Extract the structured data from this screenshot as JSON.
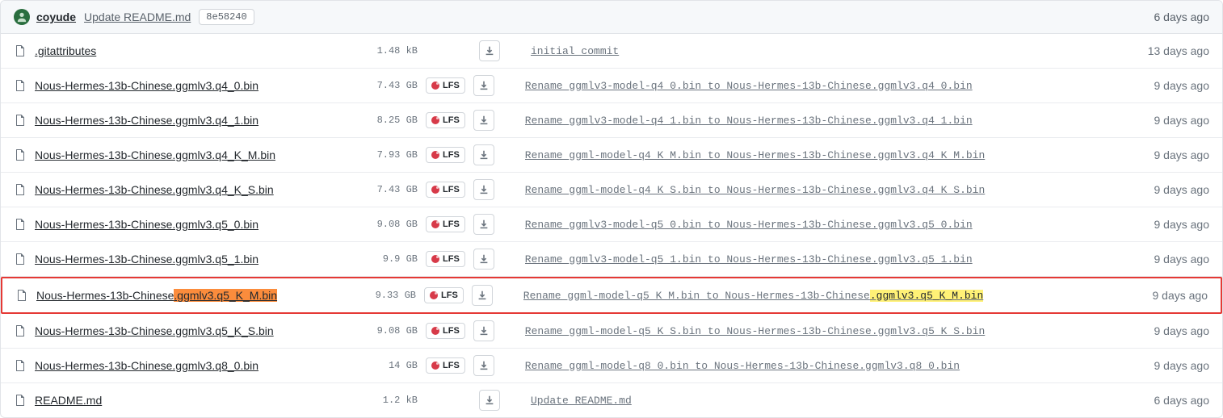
{
  "header": {
    "author": "coyude",
    "commit_title": "Update README.md",
    "commit_hash": "8e58240",
    "time": "6 days ago"
  },
  "lfs_label": "LFS",
  "rows": [
    {
      "name": ".gitattributes",
      "size": "1.48 kB",
      "lfs": false,
      "msg": "initial commit",
      "time": "13 days ago"
    },
    {
      "name": "Nous-Hermes-13b-Chinese.ggmlv3.q4_0.bin",
      "size": "7.43 GB",
      "lfs": true,
      "msg": "Rename ggmlv3-model-q4_0.bin to Nous-Hermes-13b-Chinese.ggmlv3.q4_0.bin",
      "time": "9 days ago"
    },
    {
      "name": "Nous-Hermes-13b-Chinese.ggmlv3.q4_1.bin",
      "size": "8.25 GB",
      "lfs": true,
      "underline": true,
      "msg": "Rename ggmlv3-model-q4_1.bin to Nous-Hermes-13b-Chinese.ggmlv3.q4_1.bin",
      "time": "9 days ago"
    },
    {
      "name": "Nous-Hermes-13b-Chinese.ggmlv3.q4_K_M.bin",
      "size": "7.93 GB",
      "lfs": true,
      "msg": "Rename ggml-model-q4_K_M.bin to Nous-Hermes-13b-Chinese.ggmlv3.q4_K_M.bin",
      "time": "9 days ago"
    },
    {
      "name": "Nous-Hermes-13b-Chinese.ggmlv3.q4_K_S.bin",
      "size": "7.43 GB",
      "lfs": true,
      "msg": "Rename ggml-model-q4_K_S.bin to Nous-Hermes-13b-Chinese.ggmlv3.q4_K_S.bin",
      "time": "9 days ago"
    },
    {
      "name": "Nous-Hermes-13b-Chinese.ggmlv3.q5_0.bin",
      "size": "9.08 GB",
      "lfs": true,
      "msg": "Rename ggmlv3-model-q5_0.bin to Nous-Hermes-13b-Chinese.ggmlv3.q5_0.bin",
      "time": "9 days ago"
    },
    {
      "name": "Nous-Hermes-13b-Chinese.ggmlv3.q5_1.bin",
      "size": "9.9 GB",
      "lfs": true,
      "msg": "Rename ggmlv3-model-q5_1.bin to Nous-Hermes-13b-Chinese.ggmlv3.q5_1.bin",
      "time": "9 days ago"
    },
    {
      "name_pre": "Nous-Hermes-13b-Chinese",
      "name_hl": ".ggmlv3.q5_K_M.bin",
      "size": "9.33 GB",
      "lfs": true,
      "highlighted": true,
      "msg_pre": "Rename ggml-model-q5_K_M.bin to Nous-Hermes-13b-Chinese",
      "msg_hl": ".ggmlv3.q5_K_M.bin",
      "time": "9 days ago"
    },
    {
      "name": "Nous-Hermes-13b-Chinese.ggmlv3.q5_K_S.bin",
      "size": "9.08 GB",
      "lfs": true,
      "msg": "Rename ggml-model-q5_K_S.bin to Nous-Hermes-13b-Chinese.ggmlv3.q5_K_S.bin",
      "time": "9 days ago"
    },
    {
      "name": "Nous-Hermes-13b-Chinese.ggmlv3.q8_0.bin",
      "size": "14 GB",
      "lfs": true,
      "msg": "Rename ggml-model-q8_0.bin to Nous-Hermes-13b-Chinese.ggmlv3.q8_0.bin",
      "time": "9 days ago"
    },
    {
      "name": "README.md",
      "size": "1.2 kB",
      "lfs": false,
      "msg": "Update README.md",
      "time": "6 days ago"
    }
  ]
}
